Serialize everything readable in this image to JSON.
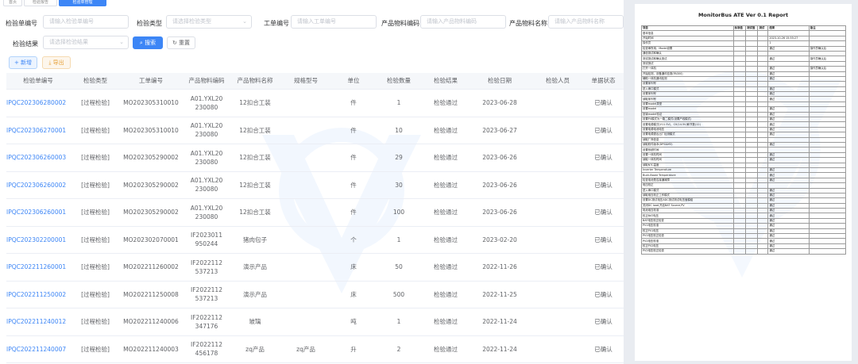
{
  "tabs": [
    "首页",
    "检验报告",
    "检验单管理"
  ],
  "filters": {
    "inspection_no": {
      "label": "检验单编号",
      "placeholder": "请输入检验单编号"
    },
    "inspection_type": {
      "label": "检验类型",
      "placeholder": "请选择检验类型"
    },
    "work_order": {
      "label": "工单编号",
      "placeholder": "请输入工单编号"
    },
    "material_code": {
      "label": "产品物料编码",
      "placeholder": "请输入产品物料编码"
    },
    "material_name": {
      "label": "产品物料名称",
      "placeholder": "请输入产品物料名称"
    },
    "result": {
      "label": "检验结果",
      "placeholder": "请选择检验结果"
    }
  },
  "buttons": {
    "search": "搜索",
    "reset": "重置",
    "add": "新增",
    "export": "导出"
  },
  "columns": [
    "检验单编号",
    "检验类型",
    "工单编号",
    "产品物料编码",
    "产品物料名称",
    "规格型号",
    "单位",
    "检验数量",
    "检验结果",
    "检验日期",
    "检验人员",
    "单据状态"
  ],
  "rows": [
    {
      "no": "IPQC202306280002",
      "type": "[过程检验]",
      "wo": "MO202305310010",
      "code": "A01.YXL20230080",
      "name": "12扣合工装",
      "spec": "",
      "unit": "件",
      "qty": "1",
      "result": "检验通过",
      "date": "2023-06-28",
      "inspector": "",
      "status": "已确认"
    },
    {
      "no": "IPQC202306270001",
      "type": "[过程检验]",
      "wo": "MO202305310010",
      "code": "A01.YXL20230080",
      "name": "12扣合工装",
      "spec": "",
      "unit": "件",
      "qty": "10",
      "result": "检验通过",
      "date": "2023-06-27",
      "inspector": "",
      "status": "已确认"
    },
    {
      "no": "IPQC202306260003",
      "type": "[过程检验]",
      "wo": "MO202305290002",
      "code": "A01.YXL20230080",
      "name": "12扣合工装",
      "spec": "",
      "unit": "件",
      "qty": "29",
      "result": "检验通过",
      "date": "2023-06-26",
      "inspector": "",
      "status": "已确认"
    },
    {
      "no": "IPQC202306260002",
      "type": "[过程检验]",
      "wo": "MO202305290002",
      "code": "A01.YXL20230080",
      "name": "12扣合工装",
      "spec": "",
      "unit": "件",
      "qty": "30",
      "result": "检验通过",
      "date": "2023-06-26",
      "inspector": "",
      "status": "已确认"
    },
    {
      "no": "IPQC202306260001",
      "type": "[过程检验]",
      "wo": "MO202305290002",
      "code": "A01.YXL20230080",
      "name": "12扣合工装",
      "spec": "",
      "unit": "件",
      "qty": "100",
      "result": "检验通过",
      "date": "2023-06-26",
      "inspector": "",
      "status": "已确认"
    },
    {
      "no": "IPQC202302200001",
      "type": "[过程检验]",
      "wo": "MO202302070001",
      "code": "IF2023011950244",
      "name": "猪肉包子",
      "spec": "",
      "unit": "个",
      "qty": "1",
      "result": "检验通过",
      "date": "2023-02-20",
      "inspector": "",
      "status": "已确认"
    },
    {
      "no": "IPQC202211260001",
      "type": "[过程检验]",
      "wo": "MO202211260002",
      "code": "IF2022112537213",
      "name": "演示产品",
      "spec": "",
      "unit": "床",
      "qty": "50",
      "result": "检验通过",
      "date": "2022-11-26",
      "inspector": "",
      "status": "已确认"
    },
    {
      "no": "IPQC202211250002",
      "type": "[过程检验]",
      "wo": "MO202211250008",
      "code": "IF2022112537213",
      "name": "演示产品",
      "spec": "",
      "unit": "床",
      "qty": "500",
      "result": "检验通过",
      "date": "2022-11-25",
      "inspector": "",
      "status": "已确认"
    },
    {
      "no": "IPQC202211240012",
      "type": "[过程检验]",
      "wo": "MO202211240006",
      "code": "IF2022112347176",
      "name": "玻璃",
      "spec": "",
      "unit": "吨",
      "qty": "1",
      "result": "检验通过",
      "date": "2022-11-24",
      "inspector": "",
      "status": "已确认"
    },
    {
      "no": "IPQC202211240007",
      "type": "[过程检验]",
      "wo": "MO202211240003",
      "code": "IF2022112456178",
      "name": "zq产品",
      "spec": "zq产品",
      "unit": "升",
      "qty": "2",
      "result": "检验通过",
      "date": "2022-11-24",
      "inspector": "",
      "status": "已确认"
    }
  ],
  "report": {
    "title": "MonitorBus ATE Ver 0.1 Report",
    "headers": [
      "项目",
      "标准值",
      "测试值",
      "测试",
      "结果",
      "备注"
    ],
    "rows": [
      [
        "基本信息",
        "",
        "",
        "",
        "",
        ""
      ],
      [
        "开始时间",
        "",
        "",
        "",
        "2023-10-26 15:55:27",
        ""
      ],
      [
        "操作员",
        "",
        "",
        "",
        "1",
        ""
      ],
      [
        "检查串所用，Model设置",
        "",
        "",
        "",
        "通过",
        "操作员确认后"
      ],
      [
        "通信测试和确认",
        "",
        "",
        "",
        "",
        ""
      ],
      [
        "测试测试和确认测试",
        "",
        "",
        "",
        "通过",
        "操作员确认后"
      ],
      [
        "测试测试",
        "",
        "",
        "",
        "",
        ""
      ],
      [
        "打开一体机",
        "",
        "",
        "",
        "通过",
        "操作员确认后"
      ],
      [
        "开始检测，设备通讯检测(PA300)",
        "",
        "",
        "",
        "通过",
        ""
      ],
      [
        "辅助一体机通讯检测",
        "",
        "",
        "",
        "通过",
        ""
      ],
      [
        "设置序列号",
        "",
        "",
        "",
        "",
        ""
      ],
      [
        "进入串口模式",
        "",
        "",
        "",
        "通过",
        ""
      ],
      [
        "设置序列号",
        "",
        "",
        "",
        "通过",
        ""
      ],
      [
        "读取序列号",
        "",
        "",
        "",
        "通过",
        ""
      ],
      [
        "设置model类型",
        "",
        "",
        "",
        "",
        ""
      ],
      [
        "设置model",
        "",
        "",
        "",
        "通过",
        ""
      ],
      [
        "回读model验证",
        "",
        "",
        "",
        "通过",
        ""
      ],
      [
        "设置PV模式为一路二模式(设置产线模式)",
        "",
        "",
        "",
        "通过",
        ""
      ],
      [
        "设置电源模式(V11.5V)，CV(14.5V)和节数(12)",
        "",
        "",
        "",
        "通过",
        ""
      ],
      [
        "设置电源电池电压",
        "",
        "",
        "",
        "通过",
        ""
      ],
      [
        "设置电源退出出厂检测模式",
        "",
        "",
        "",
        "通过",
        ""
      ],
      [
        "读取厂商信息",
        "",
        "",
        "",
        "",
        ""
      ],
      [
        "读取软件版本(DPS&M3)",
        "",
        "",
        "",
        "通过",
        ""
      ],
      [
        "设置系统时间",
        "",
        "",
        "",
        "",
        ""
      ],
      [
        "设置一体机时间",
        "",
        "",
        "",
        "通过",
        ""
      ],
      [
        "读取一体机时间",
        "",
        "",
        "",
        "通过",
        ""
      ],
      [
        "读取NTC温度",
        "",
        "",
        "",
        "",
        ""
      ],
      [
        "Inverter Temperature",
        "",
        "",
        "",
        "通过",
        ""
      ],
      [
        "Buck-Boost Temperature",
        "",
        "",
        "",
        "通过",
        ""
      ],
      [
        "检查电池是否接通故障",
        "",
        "",
        "",
        "通过",
        ""
      ],
      [
        "电压校正",
        "",
        "",
        "",
        "",
        ""
      ],
      [
        "进入串口模式",
        "",
        "",
        "",
        "通过",
        ""
      ],
      [
        "读取电压校正工作模式",
        "",
        "",
        "",
        "通过",
        ""
      ],
      [
        "设置DC测试电压ADC测试测试电压值模组",
        "",
        "",
        "",
        "通过",
        ""
      ],
      [
        "关闭DC load,开启BAT Source,PV",
        "",
        "",
        "",
        "通过",
        ""
      ],
      [
        "电池电压校准",
        "",
        "",
        "",
        "通过",
        ""
      ],
      [
        "校正BAT电压",
        "",
        "",
        "",
        "通过",
        ""
      ],
      [
        "BAT电压校正检查",
        "",
        "",
        "",
        "通过",
        ""
      ],
      [
        "PV1电压校准",
        "",
        "",
        "",
        "通过",
        ""
      ],
      [
        "校正PV1电压",
        "",
        "",
        "",
        "通过",
        ""
      ],
      [
        "PV1电压校正检查",
        "",
        "",
        "",
        "通过",
        ""
      ],
      [
        "PV2电压校准",
        "",
        "",
        "",
        "通过",
        ""
      ],
      [
        "校正PV2电压",
        "",
        "",
        "",
        "通过",
        ""
      ],
      [
        "PV2电压校正检查",
        "",
        "",
        "",
        "通过",
        ""
      ]
    ]
  }
}
